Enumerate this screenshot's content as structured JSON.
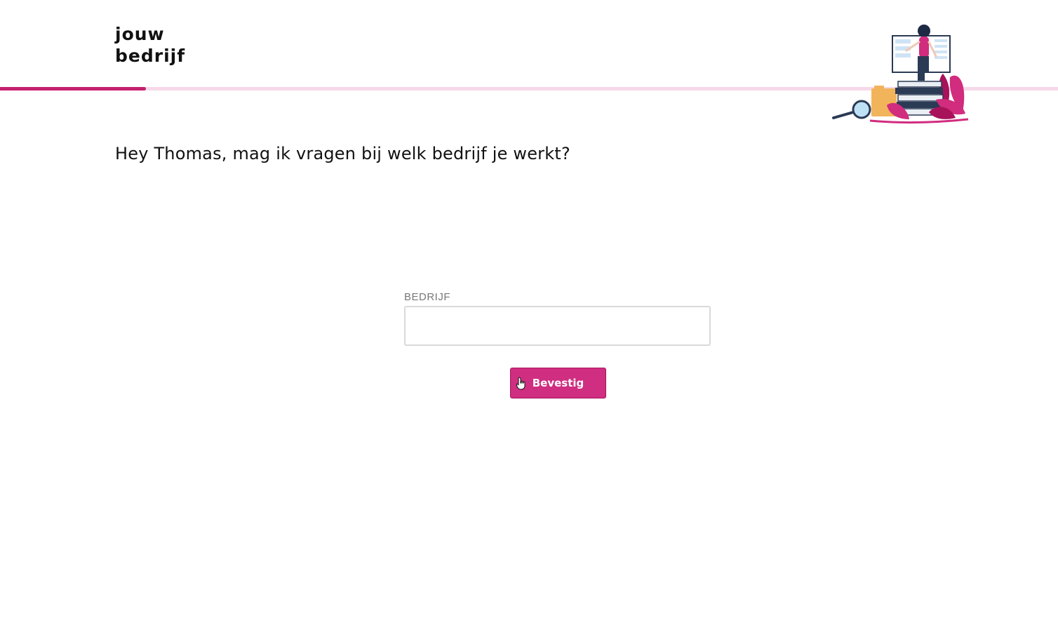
{
  "brand": {
    "line1": "jouw",
    "line2": "bedrijf"
  },
  "progress": {
    "value": 0.138,
    "color": "#c4206f",
    "track_color": "#f6d8e8"
  },
  "question": "Hey Thomas, mag ik vragen bij welk bedrijf je werkt?",
  "form": {
    "label": "BEDRIJF",
    "input_value": "",
    "placeholder": "",
    "button_label": "Bevestig",
    "accent": "#cf2e81"
  },
  "icons": {
    "illustration": "woman-presenting-screen-books-illustration",
    "cursor": "hand-pointer-cursor-icon"
  }
}
